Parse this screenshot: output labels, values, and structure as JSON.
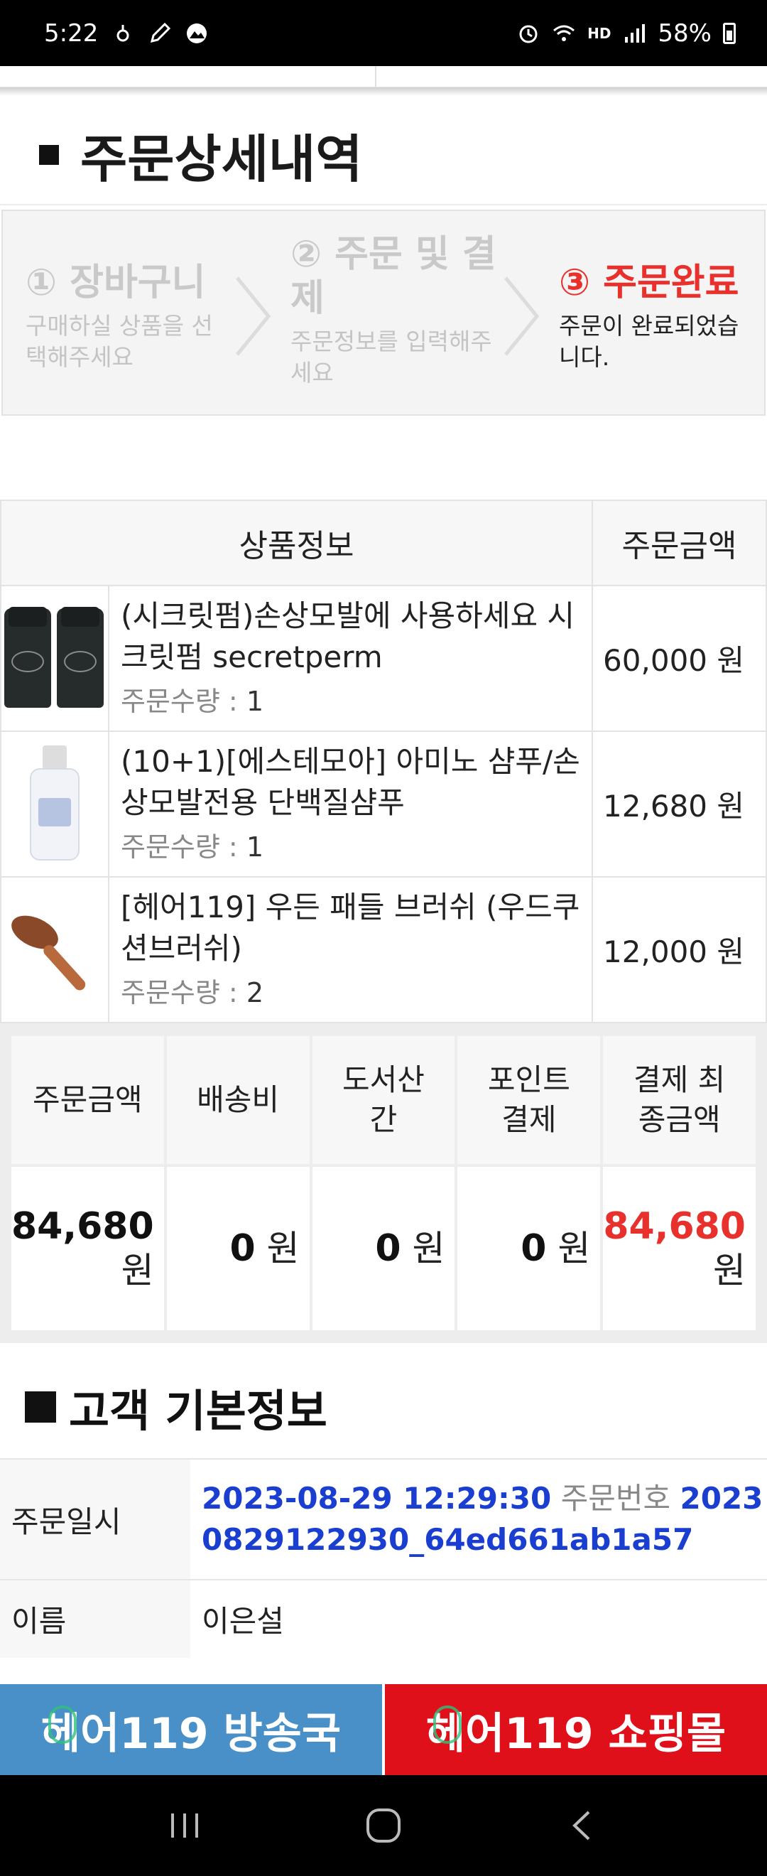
{
  "status_bar": {
    "time": "5:22",
    "hd_label": "HD",
    "battery": "58%"
  },
  "page": {
    "title": "주문상세내역"
  },
  "steps": [
    {
      "title": "① 장바구니",
      "desc": "구매하실 상품을 선택해주세요"
    },
    {
      "title": "② 주문 및 결제",
      "desc": "주문정보를 입력해주세요"
    },
    {
      "title": "③ 주문완료",
      "desc": "주문이 완료되었습니다."
    }
  ],
  "product_table": {
    "col_product": "상품정보",
    "col_amount": "주문금액",
    "qty_label": "주문수량 : ",
    "rows": [
      {
        "name": "(시크릿펌)손상모발에 사용하세요 시크릿펌 secretperm",
        "qty": "1",
        "price": "60,000 원",
        "thumb": "secretperm-bottles-image"
      },
      {
        "name": "(10+1)[에스테모아] 아미노 샴푸/손상모발전용 단백질샴푸",
        "qty": "1",
        "price": "12,680 원",
        "thumb": "shampoo-bottle-image"
      },
      {
        "name": "[헤어119] 우든 패들 브러쉬 (우드쿠션브러쉬)",
        "qty": "2",
        "price": "12,000 원",
        "thumb": "wooden-brush-image"
      }
    ]
  },
  "totals": {
    "headers": [
      "주문금액",
      "배송비",
      "도서산간",
      "포인트결제",
      "결제 최종금액"
    ],
    "values": [
      {
        "num": "84,680",
        "unit": "원"
      },
      {
        "num": "0",
        "unit": "원"
      },
      {
        "num": "0",
        "unit": "원"
      },
      {
        "num": "0",
        "unit": "원"
      },
      {
        "num": "84,680",
        "unit": "원"
      }
    ],
    "accent_color": "#e8302c"
  },
  "customer": {
    "section_title": "고객 기본정보",
    "order_date_label": "주문일시",
    "order_date": "2023-08-29 12:29:30",
    "order_no_label": "주문번호",
    "order_no": "20230829122930_64ed661ab1a57",
    "name_label": "이름",
    "name": "이은설"
  },
  "banners": {
    "left": "헤어119 방송국",
    "right": "헤어119 쇼핑몰"
  }
}
